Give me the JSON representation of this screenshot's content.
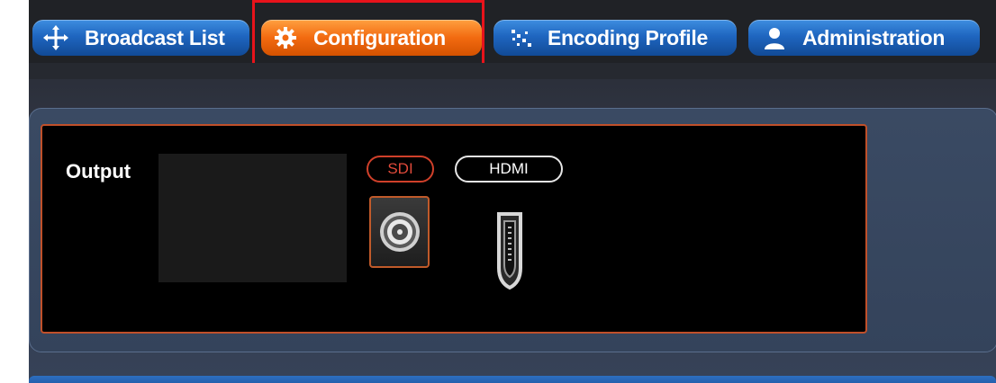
{
  "nav": {
    "tabs": [
      {
        "label": "Broadcast List",
        "icon": "move-arrows-icon",
        "active": false
      },
      {
        "label": "Configuration",
        "icon": "gear-icon",
        "active": true
      },
      {
        "label": "Encoding Profile",
        "icon": "encoding-dots-icon",
        "active": false
      },
      {
        "label": "Administration",
        "icon": "user-icon",
        "active": false
      }
    ]
  },
  "output": {
    "label": "Output",
    "sdi_label": "SDI",
    "hdmi_label": "HDMI",
    "selected": "SDI"
  },
  "colors": {
    "tab_blue": "#1f66c0",
    "tab_active": "#f26a10",
    "highlight": "#e8131b",
    "panel_border": "#c0502a"
  }
}
